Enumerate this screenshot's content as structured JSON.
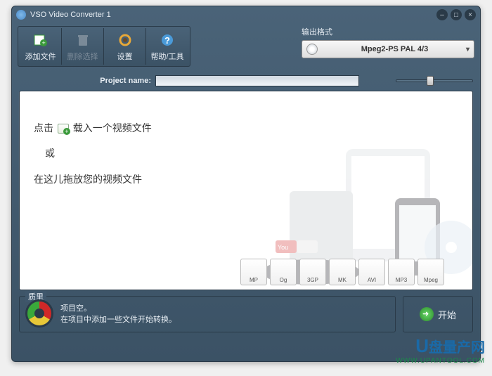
{
  "titlebar": {
    "title": "VSO Video Converter 1"
  },
  "toolbar": {
    "add_file": "添加文件",
    "delete_sel": "删除选择",
    "settings": "设置",
    "help_tools": "帮助/工具"
  },
  "output": {
    "label": "输出格式",
    "selected": "Mpeg2-PS PAL 4/3"
  },
  "project": {
    "label": "Project name:"
  },
  "hints": {
    "line1a": "点击",
    "line1b": "载入一个视频文件",
    "line2": "或",
    "line3": "在这儿拖放您的视频文件"
  },
  "formats": [
    "MP",
    "Og",
    "3GP",
    "MK",
    "AVI",
    "MP3",
    "Mpeg"
  ],
  "quality": {
    "title": "质里",
    "line1": "项目空。",
    "line2": "在项目中添加一些文件开始转换。"
  },
  "start": {
    "label": "开始"
  },
  "watermark": {
    "text": "盘量产网",
    "url": "WWW.UPANTOOL.COM"
  }
}
